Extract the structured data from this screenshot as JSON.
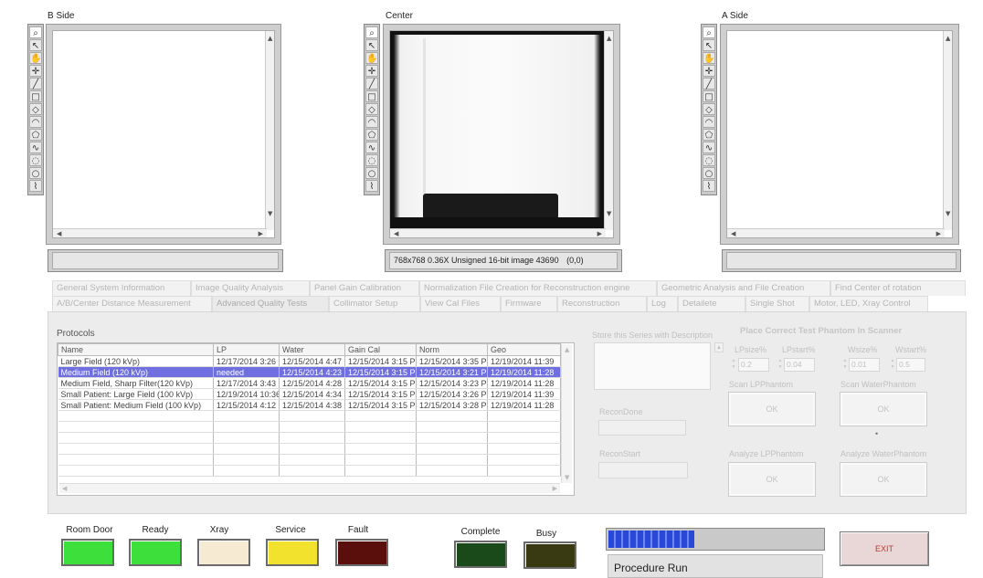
{
  "views": {
    "b_side": {
      "title": "B Side"
    },
    "center": {
      "title": "Center",
      "status": "768x768 0.36X Unsigned 16-bit image 43690",
      "coords": "(0,0)"
    },
    "a_side": {
      "title": "A Side"
    }
  },
  "tools": [
    "zoom-icon",
    "pointer-icon",
    "pan-icon",
    "crosshair-icon",
    "line-icon",
    "rectangle-icon",
    "rotated-rectangle-icon",
    "annulus-icon",
    "polygon-icon",
    "freehand-icon",
    "freehand-region-icon",
    "oval-icon",
    "broken-line-icon"
  ],
  "tabs": {
    "row1": [
      "General System Information",
      "Image Quality Analysis",
      "Panel Gain Calibration",
      "Normalization File Creation for Reconstruction engine",
      "Geometric Analysis and File Creation",
      "Find Center of rotation"
    ],
    "row2": [
      "A/B/Center Distance Measurement",
      "Advanced Quality Tests",
      "Collimator Setup",
      "View Cal Files",
      "Firmware",
      "Reconstruction",
      "Log",
      "Detailete",
      "Single Shot",
      "Motor, LED, Xray Control"
    ]
  },
  "protocols": {
    "label": "Protocols",
    "columns": [
      "Name",
      "LP",
      "Water",
      "Gain Cal",
      "Norm",
      "Geo"
    ],
    "rows": [
      [
        "Large Field (120 kVp)",
        "12/17/2014 3:26",
        "12/15/2014 4:47",
        "12/15/2014 3:15 P",
        "12/15/2014 3:35 P",
        "12/19/2014 11:39"
      ],
      [
        "Medium Field (120 kVp)",
        "needed",
        "12/15/2014 4:23",
        "12/15/2014 3:15 P",
        "12/15/2014 3:21 P",
        "12/19/2014 11:28"
      ],
      [
        "Medium Field, Sharp Filter(120 kVp)",
        "12/17/2014 3:43",
        "12/15/2014 4:28",
        "12/15/2014 3:15 P",
        "12/15/2014 3:23 P",
        "12/19/2014 11:28"
      ],
      [
        "Small Patient: Large Field (100 kVp)",
        "12/19/2014 10:36",
        "12/15/2014 4:34",
        "12/15/2014 3:15 P",
        "12/15/2014 3:26 P",
        "12/19/2014 11:39"
      ],
      [
        "Small Patient: Medium Field (100 kVp)",
        "12/15/2014 4:12",
        "12/15/2014 4:38",
        "12/15/2014 3:15 P",
        "12/15/2014 3:28 P",
        "12/19/2014 11:28"
      ]
    ],
    "selected_row": 1
  },
  "series": {
    "store_label": "Store this Series with Description",
    "recon_done_label": "ReconDone",
    "recon_start_label": "ReconStart"
  },
  "phantom": {
    "title": "Place Correct Test Phantom In Scanner",
    "lpsize_label": "LPsize%",
    "lpsize_value": "0.2",
    "lpstart_label": "LPstart%",
    "lpstart_value": "0.04",
    "wsize_label": "Wsize%",
    "wsize_value": "0.01",
    "wstart_label": "Wstart%",
    "wstart_value": "0.5",
    "scan_lp_label": "Scan LPPhantom",
    "scan_water_label": "Scan WaterPhantom",
    "analyze_lp_label": "Analyze LPPhantom",
    "analyze_water_label": "Analyze WaterPhantom",
    "ok_label": "OK",
    "dot": "•"
  },
  "indicators": [
    {
      "label": "Room Door",
      "color": "#3de03a"
    },
    {
      "label": "Ready",
      "color": "#3de03a"
    },
    {
      "label": "Xray",
      "color": "#f6ead2"
    },
    {
      "label": "Service",
      "color": "#f2e22e"
    },
    {
      "label": "Fault",
      "color": "#5a0f0c"
    },
    {
      "label": "Complete",
      "color": "#1a4a1a"
    },
    {
      "label": "Busy",
      "color": "#3a3a12"
    }
  ],
  "progress": {
    "fraction": 0.4,
    "status": "Procedure Run"
  },
  "exit_label": "EXIT"
}
